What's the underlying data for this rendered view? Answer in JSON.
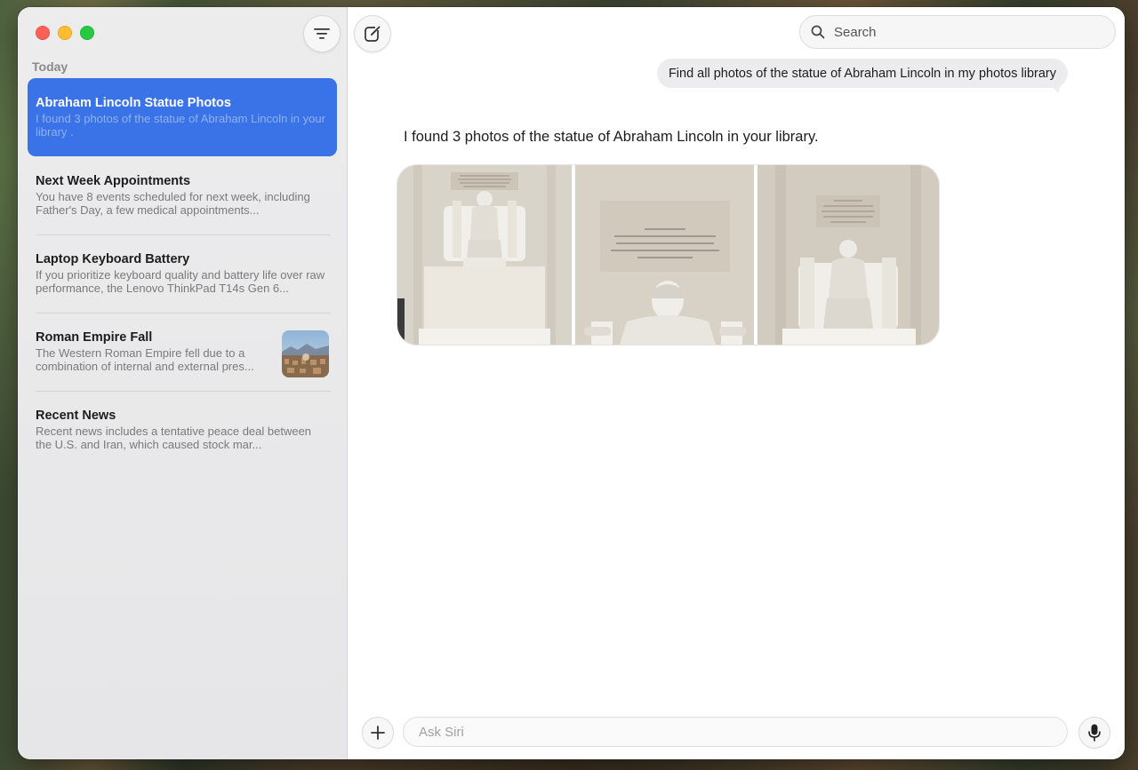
{
  "sidebar": {
    "section_label": "Today",
    "conversations": [
      {
        "title": "Abraham Lincoln Statue Photos",
        "snippet": "I found 3 photos of the statue of Abraham Lincoln in your library ."
      },
      {
        "title": "Next Week Appointments",
        "snippet": "You have 8 events scheduled for next week, including Father's Day, a few medical appointments..."
      },
      {
        "title": "Laptop Keyboard Battery",
        "snippet": "If you prioritize keyboard quality and battery life over raw performance, the Lenovo ThinkPad T14s Gen 6..."
      },
      {
        "title": "Roman Empire Fall",
        "snippet": "The Western Roman Empire fell due to a combination of internal and external pres..."
      },
      {
        "title": "Recent News",
        "snippet": "Recent news includes a tentative peace deal between the U.S. and Iran, which caused stock mar..."
      }
    ]
  },
  "search": {
    "placeholder": "Search"
  },
  "chat": {
    "user_message": "Find all photos of the statue of Abraham Lincoln in my photos library",
    "assistant_message": "I found 3 photos of the statue of Abraham Lincoln in your library."
  },
  "composer": {
    "placeholder": "Ask Siri"
  },
  "icons": {
    "filter": "filter-lines-icon",
    "compose": "compose-icon",
    "search": "search-icon",
    "plus": "plus-icon",
    "mic": "microphone-icon"
  },
  "colors": {
    "selected_row": "#3a72e8",
    "traffic_red": "#fe5f57",
    "traffic_yellow": "#febc2e",
    "traffic_green": "#28c840"
  }
}
